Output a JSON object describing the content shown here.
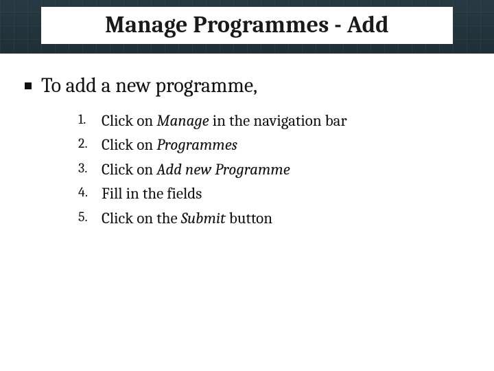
{
  "title": "Manage Programmes - Add",
  "lead": "To add a new programme,",
  "steps": [
    {
      "pre": "Click on ",
      "em": "Manage",
      "post": " in the navigation bar"
    },
    {
      "pre": "Click on ",
      "em": "Programmes",
      "post": ""
    },
    {
      "pre": "Click on ",
      "em": "Add new Programme",
      "post": ""
    },
    {
      "pre": "Fill in the fields",
      "em": "",
      "post": ""
    },
    {
      "pre": "Click on the ",
      "em": "Submit",
      "post": " button"
    }
  ]
}
